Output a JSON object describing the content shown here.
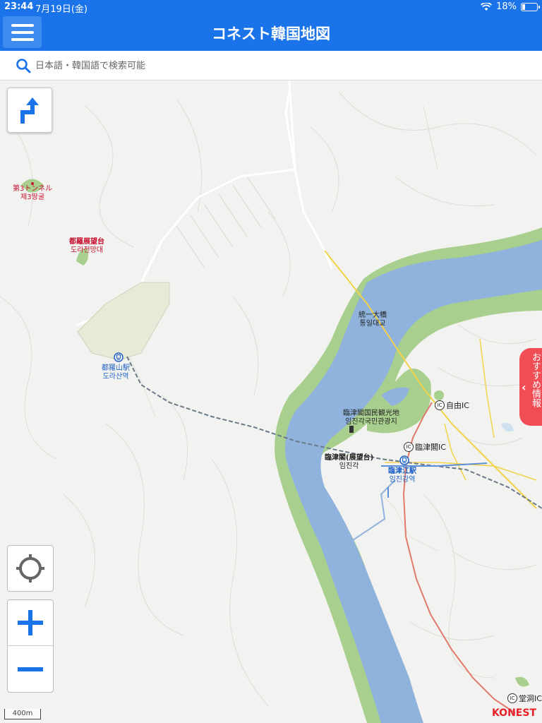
{
  "status_bar": {
    "time": "23:44",
    "date": "7月19日(金)",
    "battery": "18%",
    "battery_level": 0.18
  },
  "header": {
    "title": "コネスト韓国地図"
  },
  "search": {
    "placeholder": "日本語・韓国語で検索可能"
  },
  "map": {
    "places": [
      {
        "ja": "第3トンネル",
        "ko": "제3땅굴",
        "type": "attraction"
      },
      {
        "ja": "都羅展望台",
        "ko": "도라전망대",
        "type": "attraction"
      },
      {
        "ja": "都羅山駅",
        "ko": "도라산역",
        "type": "station"
      },
      {
        "ja": "統一大橋",
        "ko": "통일대교",
        "type": "bridge"
      },
      {
        "ja": "臨津閣国民観光地",
        "ko": "임진각국민관광지",
        "type": "park"
      },
      {
        "ja": "臨津閣(展望台)",
        "ko": "임진각",
        "type": "landmark"
      },
      {
        "ja": "臨津江駅",
        "ko": "임진강역",
        "type": "station"
      }
    ],
    "interchanges": [
      "自由IC",
      "臨津閣IC",
      "堂洞IC"
    ],
    "ic_badge": "IC",
    "scale": "400m"
  },
  "controls": {
    "recommend_label": "おすすめ情報",
    "recommend_chevron": "‹"
  },
  "brand": "KONEST",
  "colors": {
    "primary": "#1a73e8",
    "river": "#8fb3dc",
    "bank": "#a9cf8e",
    "land": "#f2f2f0",
    "accent": "#f04e54",
    "label_red": "#c8102e",
    "label_blue": "#1a5fc8"
  }
}
